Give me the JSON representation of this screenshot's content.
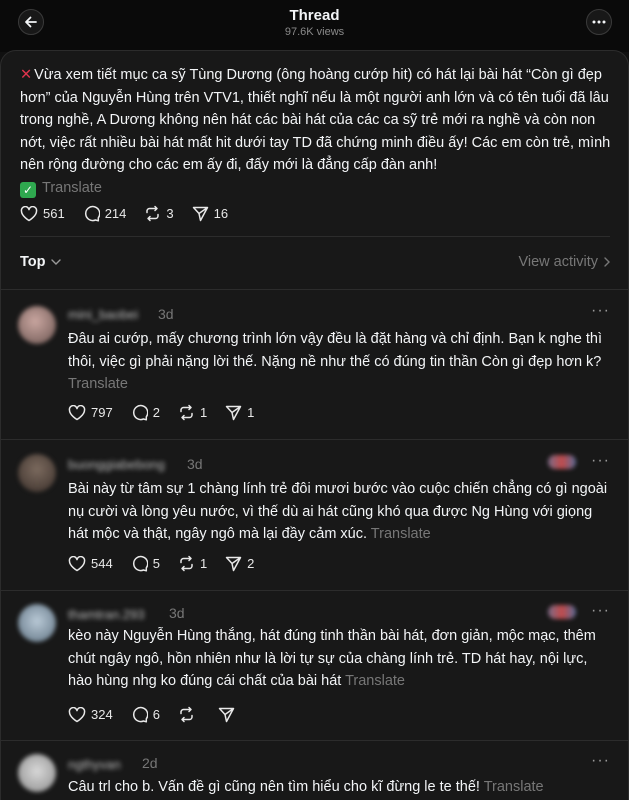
{
  "header": {
    "title": "Thread",
    "views": "97.6K views"
  },
  "post": {
    "text": "Vừa xem tiết mục ca sỹ Tùng Dương (ông hoàng cướp hit) có hát lại bài hát “Còn gì đẹp hơn” của Nguyễn Hùng trên VTV1, thiết nghĩ nếu là một người anh lớn và có tên tuổi đã lâu trong nghề, A Dương không nên hát các bài hát của các ca sỹ trẻ mới ra nghề và còn non nớt, việc rất nhiều bài hát mất hit dưới tay TD đã chứng minh điều ấy! Các em còn trẻ, mình nên rộng đường cho các em ấy đi, đấy mới là đẳng cấp đàn anh!",
    "translate": "Translate",
    "likes": "561",
    "replies": "214",
    "reposts": "3",
    "shares": "16"
  },
  "sort": {
    "label": "Top",
    "view_activity": "View activity"
  },
  "comments": [
    {
      "username": "mini_baobei",
      "time": "3d",
      "text": "Đâu ai cướp, mấy chương trình lớn vậy đều là đặt hàng và chỉ định. Bạn k nghe thì thôi, việc gì phải nặng lời thế. Nặng nề như thế có đúng tin thần Còn gì đẹp hơn k?",
      "translate": "Translate",
      "likes": "797",
      "replies": "2",
      "reposts": "1",
      "shares": "1"
    },
    {
      "username": "buonggiabebong",
      "time": "3d",
      "text": "Bài này từ tâm sự 1 chàng lính trẻ đôi mươi bước vào cuộc chiến chẳng có gì ngoài nụ cười và lòng yêu nước, vì thế dù ai hát cũng khó qua được Ng Hùng với giọng hát mộc và thật, ngây ngô mà lại đầy cảm xúc.",
      "translate": "Translate",
      "likes": "544",
      "replies": "5",
      "reposts": "1",
      "shares": "2"
    },
    {
      "username": "thamtran.293",
      "time": "3d",
      "text": "kèo này Nguyễn Hùng thắng, hát đúng tinh thần bài hát, đơn giản, mộc mạc, thêm chút ngây ngô, hồn nhiên như là lời tự sự của chàng lính trẻ. TD hát hay, nội lực, hào hùng nhg ko đúng cái chất của bài hát",
      "translate": "Translate",
      "likes": "324",
      "replies": "6",
      "reposts": "",
      "shares": ""
    },
    {
      "username": "ngthyvan",
      "time": "2d",
      "text": "Câu trl cho b. Vấn đề gì cũng nên tìm hiểu cho kĩ đừng le te thế!",
      "translate": "Translate"
    }
  ],
  "colors": {
    "background": "#101010",
    "card": "#181818",
    "muted": "#777777",
    "checkmark_green": "#2fa84f",
    "cross_red": "#e0344d"
  }
}
